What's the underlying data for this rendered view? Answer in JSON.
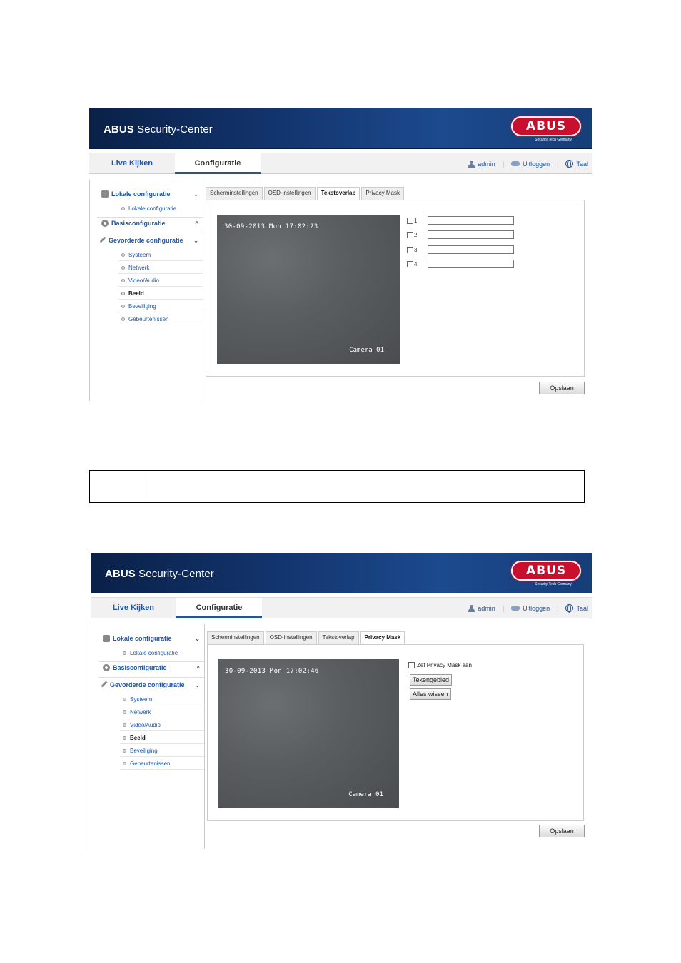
{
  "app": {
    "brand_bold": "ABUS",
    "brand_rest": " Security-Center",
    "logo_text": "ABUS",
    "logo_sub": "Security Tech Germany"
  },
  "nav": {
    "live": "Live Kijken",
    "config": "Configuratie",
    "user": "admin",
    "logout": "Uitloggen",
    "lang": "Taal",
    "sep": "|"
  },
  "sidebar": {
    "local_head": "Lokale configuratie",
    "local_item": "Lokale configuratie",
    "basic_head": "Basisconfiguratie",
    "adv_head": "Gevorderde configuratie",
    "items": [
      "Systeem",
      "Netwerk",
      "Video/Audio",
      "Beeld",
      "Beveiliging",
      "Gebeurtenissen"
    ],
    "chev_down": "⌄",
    "chev_up": "^"
  },
  "tabs": [
    "Scherminstellingen",
    "OSD-instellingen",
    "Tekstoverlap",
    "Privacy Mask"
  ],
  "shot1": {
    "timestamp": "30-09-2013 Mon 17:02:23",
    "camera": "Camera 01",
    "overlay_labels": [
      "1",
      "2",
      "3",
      "4"
    ],
    "overlay_values": [
      "",
      "",
      "",
      ""
    ]
  },
  "shot2": {
    "timestamp": "30-09-2013 Mon 17:02:46",
    "camera": "Camera 01",
    "privacy_enable": "Zet Privacy Mask aan",
    "draw_btn": "Tekengebied",
    "clear_btn": "Alles wissen"
  },
  "save": "Opslaan",
  "note": {
    "text": ""
  },
  "colors": {
    "accent": "#1f56a6",
    "banner": "#12336b",
    "logo": "#c8102e"
  }
}
